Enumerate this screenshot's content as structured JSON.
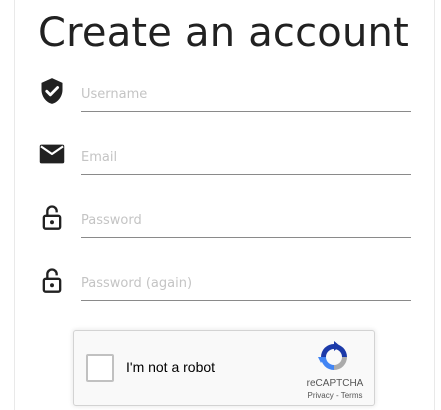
{
  "page": {
    "title": "Create an account"
  },
  "form": {
    "fields": [
      {
        "icon": "shield-check-icon",
        "placeholder": "Username",
        "value": ""
      },
      {
        "icon": "envelope-icon",
        "placeholder": "Email",
        "value": ""
      },
      {
        "icon": "unlock-icon",
        "placeholder": "Password",
        "value": ""
      },
      {
        "icon": "unlock-icon",
        "placeholder": "Password (again)",
        "value": ""
      }
    ]
  },
  "recaptcha": {
    "label": "I'm not a robot",
    "brand": "reCAPTCHA",
    "privacy": "Privacy",
    "separator": " - ",
    "terms": "Terms",
    "checked": false
  },
  "colors": {
    "icon": "#212121",
    "underline": "#8a8a8a",
    "placeholder": "#c4c4c4",
    "recaptcha_blue": "#1c3aa9",
    "recaptcha_lightblue": "#4285f4",
    "recaptcha_gray": "#ababab"
  }
}
